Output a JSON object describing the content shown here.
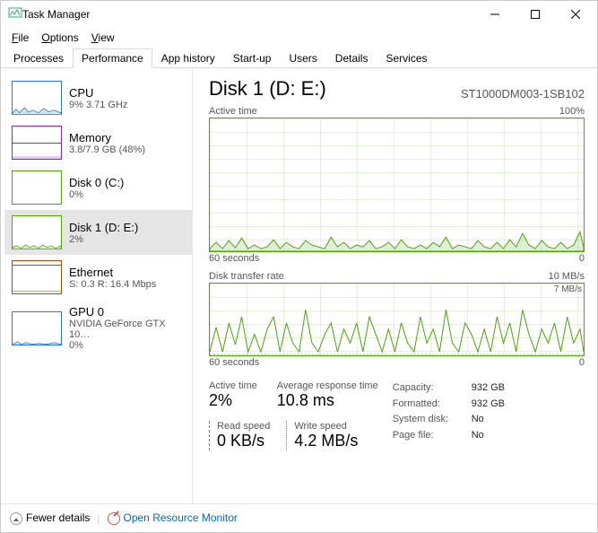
{
  "window": {
    "title": "Task Manager"
  },
  "menu": {
    "file": "File",
    "options": "Options",
    "view": "View"
  },
  "tabs": {
    "processes": "Processes",
    "performance": "Performance",
    "app_history": "App history",
    "startup": "Start-up",
    "users": "Users",
    "details": "Details",
    "services": "Services"
  },
  "sidebar": [
    {
      "name": "CPU",
      "sub": "9% 3.71 GHz",
      "type": "cpu"
    },
    {
      "name": "Memory",
      "sub": "3.8/7.9 GB (48%)",
      "type": "mem"
    },
    {
      "name": "Disk 0 (C:)",
      "sub": "0%",
      "type": "disk"
    },
    {
      "name": "Disk 1 (D: E:)",
      "sub": "2%",
      "type": "disk",
      "selected": true
    },
    {
      "name": "Ethernet",
      "sub": "S: 0.3  R: 16.4 Mbps",
      "type": "eth"
    },
    {
      "name": "GPU 0",
      "sub": "NVIDIA GeForce GTX 10…",
      "type": "gpu",
      "sub2": "0%"
    }
  ],
  "main": {
    "title": "Disk 1 (D: E:)",
    "model": "ST1000DM003-1SB102",
    "chart1": {
      "label": "Active time",
      "max": "100%",
      "xleft": "60 seconds",
      "xright": "0"
    },
    "chart2": {
      "label": "Disk transfer rate",
      "max": "10 MB/s",
      "mark": "7 MB/s",
      "xleft": "60 seconds",
      "xright": "0"
    },
    "stats": {
      "active_time": {
        "label": "Active time",
        "value": "2%"
      },
      "avg_response": {
        "label": "Average response time",
        "value": "10.8 ms"
      },
      "read_speed": {
        "label": "Read speed",
        "value": "0 KB/s"
      },
      "write_speed": {
        "label": "Write speed",
        "value": "4.2 MB/s"
      }
    },
    "kv": {
      "capacity_k": "Capacity:",
      "capacity_v": "932 GB",
      "formatted_k": "Formatted:",
      "formatted_v": "932 GB",
      "sysdisk_k": "System disk:",
      "sysdisk_v": "No",
      "pagefile_k": "Page file:",
      "pagefile_v": "No"
    }
  },
  "footer": {
    "fewer": "Fewer details",
    "resmon": "Open Resource Monitor"
  },
  "chart_data": [
    {
      "type": "area",
      "title": "Active time",
      "ylabel": "%",
      "ylim": [
        0,
        100
      ],
      "xlabel": "seconds",
      "xlim": [
        60,
        0
      ],
      "values": [
        3,
        5,
        2,
        6,
        3,
        8,
        2,
        4,
        2,
        3,
        7,
        2,
        5,
        3,
        2,
        6,
        4,
        3,
        2,
        8,
        3,
        5,
        2,
        4,
        3,
        6,
        2,
        3,
        5,
        2,
        7,
        3,
        2,
        4,
        2,
        5,
        3,
        8,
        2,
        4,
        3,
        2,
        6,
        3,
        2,
        5,
        2,
        7,
        3,
        10,
        4,
        2,
        6,
        3,
        2,
        5,
        2,
        4,
        12,
        3
      ]
    },
    {
      "type": "line",
      "title": "Disk transfer rate",
      "ylabel": "MB/s",
      "ylim": [
        0,
        10
      ],
      "xlabel": "seconds",
      "xlim": [
        60,
        0
      ],
      "annotations": [
        "7 MB/s"
      ],
      "series": [
        {
          "name": "Write speed",
          "values": [
            1,
            4,
            1,
            5,
            2,
            6,
            1,
            3,
            1,
            4,
            6,
            1,
            5,
            2,
            1,
            7,
            2,
            1,
            3,
            5,
            1,
            4,
            2,
            5,
            1,
            6,
            3,
            1,
            4,
            1,
            5,
            2,
            1,
            6,
            2,
            4,
            1,
            7,
            2,
            1,
            5,
            3,
            1,
            4,
            1,
            6,
            2,
            5,
            1,
            7,
            3,
            1,
            4,
            2,
            5,
            1,
            6,
            2,
            4,
            1
          ]
        },
        {
          "name": "Read speed",
          "values": [
            0,
            0,
            0,
            0,
            0,
            0,
            0,
            0,
            0,
            0,
            0,
            0,
            0,
            0,
            0,
            0,
            0,
            0,
            0,
            0,
            0,
            0,
            0,
            0,
            0,
            0,
            0,
            0,
            0,
            0,
            0,
            0,
            0,
            0,
            0,
            0,
            0,
            0,
            0,
            0,
            0,
            0,
            0,
            0,
            0,
            0,
            0,
            0,
            0,
            0,
            0,
            0,
            0,
            0,
            0,
            0,
            0,
            0,
            0,
            0
          ]
        }
      ]
    }
  ]
}
